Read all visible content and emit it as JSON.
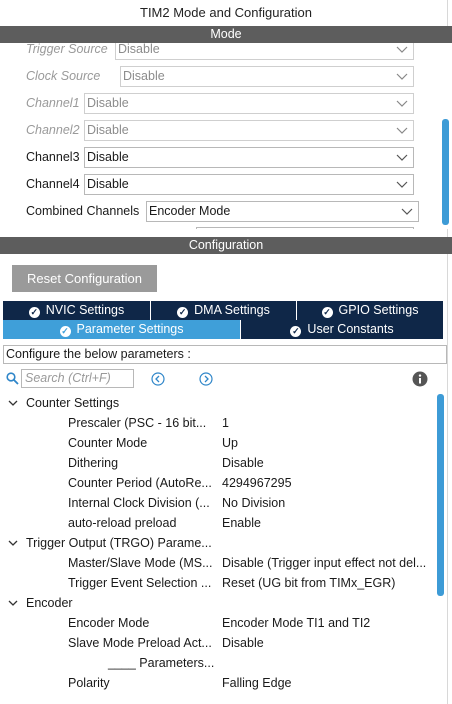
{
  "window_title": "TIM2 Mode and Configuration",
  "mode_header": "Mode",
  "mode_rows": [
    {
      "label": "Trigger Source",
      "value": "Disable",
      "disabled": true
    },
    {
      "label": "Clock Source",
      "value": "Disable",
      "disabled": true
    },
    {
      "label": "Channel1",
      "value": "Disable",
      "disabled": true
    },
    {
      "label": "Channel2",
      "value": "Disable",
      "disabled": true
    },
    {
      "label": "Channel3",
      "value": "Disable",
      "disabled": false
    },
    {
      "label": "Channel4",
      "value": "Disable",
      "disabled": false
    },
    {
      "label": "Combined Channels",
      "value": "Encoder Mode",
      "disabled": false
    }
  ],
  "config_header": "Configuration",
  "reset_button": "Reset Configuration",
  "tabs": {
    "nvic": "NVIC Settings",
    "dma": "DMA Settings",
    "gpio": "GPIO Settings",
    "parameter": "Parameter Settings",
    "user_constants": "User Constants"
  },
  "configure_note": "Configure the below parameters :",
  "search_placeholder": "Search (Ctrl+F)",
  "groups": {
    "counter": "Counter Settings",
    "trgo": "Trigger Output (TRGO) Parame...",
    "encoder": "Encoder"
  },
  "params": {
    "prescaler": {
      "name": "Prescaler (PSC - 16 bit...",
      "value": "1"
    },
    "counter_mode": {
      "name": "Counter Mode",
      "value": "Up"
    },
    "dithering": {
      "name": "Dithering",
      "value": "Disable"
    },
    "counter_period": {
      "name": "Counter Period (AutoRe...",
      "value": "4294967295"
    },
    "clock_division": {
      "name": "Internal Clock Division (...",
      "value": "No Division"
    },
    "auto_reload": {
      "name": "auto-reload preload",
      "value": "Enable"
    },
    "master_slave": {
      "name": "Master/Slave Mode (MS...",
      "value": "Disable (Trigger input effect not del..."
    },
    "trigger_event": {
      "name": "Trigger Event Selection ...",
      "value": "Reset (UG bit from TIMx_EGR)"
    },
    "encoder_mode": {
      "name": "Encoder Mode",
      "value": "Encoder Mode TI1 and TI2"
    },
    "slave_preload": {
      "name": "Slave Mode Preload Act...",
      "value": "Disable"
    },
    "sub_parameters": {
      "name": "____ Parameters..."
    },
    "polarity": {
      "name": "Polarity",
      "value": "Falling Edge"
    }
  },
  "colors": {
    "section_header": "#5d5d5d",
    "tab_dark": "#0f2748",
    "tab_active": "#3f9fd9",
    "scrollbar": "#3d9bd6"
  },
  "icons": [
    "chevron-down-icon",
    "check-circle-icon",
    "search-icon",
    "prev-arrow-icon",
    "next-arrow-icon",
    "info-icon",
    "collapse-icon"
  ]
}
